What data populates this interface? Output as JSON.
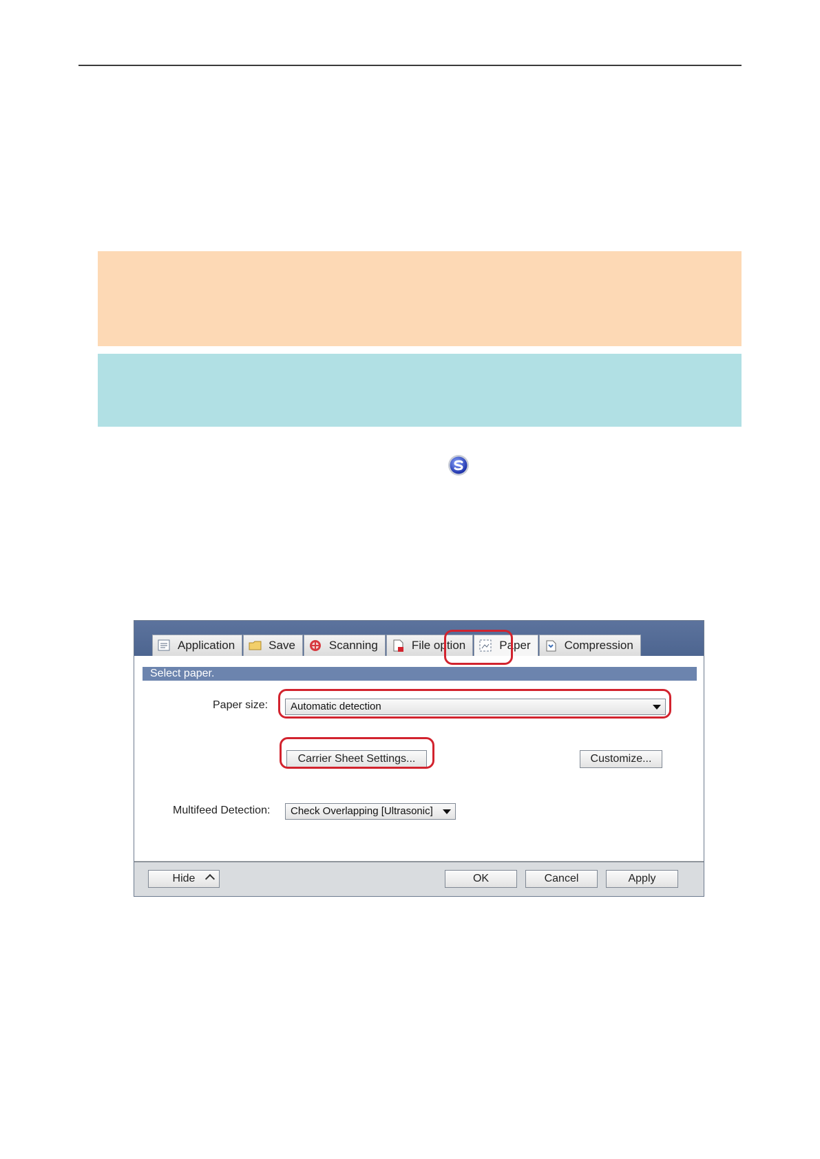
{
  "dialog": {
    "tabs": [
      {
        "label": "Application",
        "icon": "application-icon"
      },
      {
        "label": "Save",
        "icon": "folder-icon"
      },
      {
        "label": "Scanning",
        "icon": "scanning-icon"
      },
      {
        "label": "File option",
        "icon": "file-option-icon"
      },
      {
        "label": "Paper",
        "icon": "paper-icon",
        "active": true
      },
      {
        "label": "Compression",
        "icon": "compression-icon"
      }
    ],
    "section_title": "Select paper.",
    "paper_size": {
      "label": "Paper size:",
      "value": "Automatic detection"
    },
    "carrier_sheet_button": "Carrier Sheet Settings...",
    "customize_button": "Customize...",
    "multifeed": {
      "label": "Multifeed Detection:",
      "value": "Check Overlapping [Ultrasonic]"
    },
    "footer": {
      "hide": "Hide",
      "ok": "OK",
      "cancel": "Cancel",
      "apply": "Apply"
    }
  },
  "colors": {
    "note_orange": "#fdd9b5",
    "note_blue": "#b1e0e4",
    "title_bar": "#5c739d",
    "highlight": "#d2232e"
  }
}
